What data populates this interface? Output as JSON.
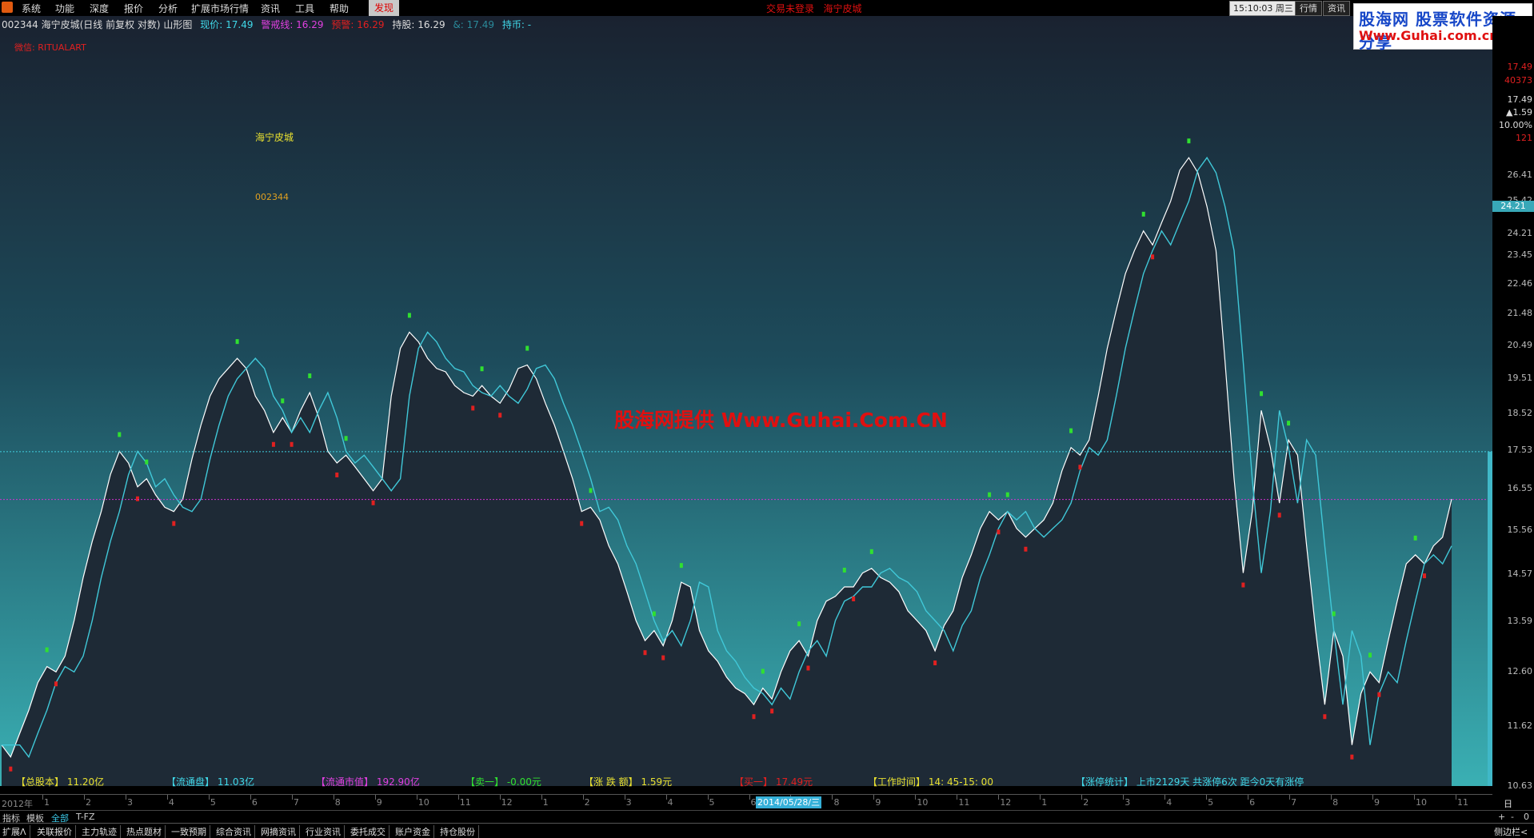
{
  "menubar": {
    "items": [
      "系统",
      "功能",
      "深度",
      "报价",
      "分析",
      "扩展市场行情",
      "资讯",
      "工具",
      "帮助",
      "发现"
    ],
    "notice": "交易未登录",
    "stock_name": "海宁皮城",
    "time": "15:10:03 周三",
    "buttons": [
      "行情",
      "资讯"
    ]
  },
  "watermark_logo": {
    "line1": "股海网 股票软件资源分享",
    "line2": "Www.Guhai.com.cn"
  },
  "info_line": {
    "title": "002344 海宁皮城(日线 前复权 对数) 山形图",
    "price_label": "现价: 17.49",
    "warn_label": "警戒线: 16.29",
    "alert_label": "预警: 16.29",
    "hold_label": "持股: 16.29",
    "amp_label": "&: 17.49",
    "coin_label": "持币: -"
  },
  "wechat": "微信: RITUALART",
  "annotations": {
    "name": "海宁皮城",
    "code": "002344"
  },
  "watermark_text": "股海网提供 Www.Guhai.Com.CN",
  "right_axis": {
    "quote": {
      "price": "17.49",
      "volume": "40373",
      "last": "17.49",
      "change": "▲1.59",
      "pct": "10.00%",
      "num": "121"
    },
    "ticks": [
      "26.41",
      "25.42",
      "24.21",
      "23.45",
      "22.46",
      "21.48",
      "20.49",
      "19.51",
      "18.52",
      "17.53",
      "16.55",
      "15.56",
      "14.57",
      "13.59",
      "12.60",
      "11.62",
      "10.63"
    ],
    "current_label": "24.21"
  },
  "stats": [
    {
      "label": "【总股本】",
      "value": "11.20亿",
      "color": "#e8e030"
    },
    {
      "label": "【流通盘】",
      "value": "11.03亿",
      "color": "#40d8e8"
    },
    {
      "label": "【流通市值】",
      "value": "192.90亿",
      "color": "#e040e0"
    },
    {
      "label": "【卖一】",
      "value": "-0.00元",
      "color": "#30e030"
    },
    {
      "label": "【涨 跌 额】",
      "value": "1.59元",
      "color": "#e8e030"
    },
    {
      "label": "【买一】",
      "value": "17.49元",
      "color": "#e02020"
    },
    {
      "label": "【工作时间】",
      "value": "14: 45-15: 00",
      "color": "#e8e030"
    },
    {
      "label": "【涨停统计】",
      "value": "上市2129天    共涨停6次    距今0天有涨停",
      "color": "#40d8e8"
    }
  ],
  "time_axis": {
    "year": "2012年",
    "months": [
      "1",
      "2",
      "3",
      "4",
      "5",
      "6",
      "7",
      "8",
      "9",
      "10",
      "11",
      "12",
      "1",
      "2",
      "3",
      "4",
      "5",
      "6",
      "7",
      "8",
      "9",
      "10",
      "11",
      "12",
      "1",
      "2",
      "3",
      "4",
      "5",
      "6",
      "7",
      "8",
      "9",
      "10",
      "11"
    ],
    "cursor_date": "2014/05/28/三",
    "period": "日线"
  },
  "tabs": [
    "指标",
    "模板",
    "全部",
    "T-FZ"
  ],
  "tab_controls": [
    "+",
    "-",
    "0"
  ],
  "bottom_buttons": [
    "扩展Λ",
    "关联报价",
    "主力轨迹",
    "热点题材",
    "一致预期",
    "综合资讯",
    "网摘资讯",
    "行业资讯",
    "委托成交",
    "账户资金",
    "持仓股份"
  ],
  "sidebar_toggle": "侧边栏<",
  "chart_data": {
    "type": "area",
    "title": "002344 海宁皮城(日线 前复权 对数) 山形图",
    "ylim": [
      10.63,
      27.4
    ],
    "yticks": [
      26.41,
      25.42,
      24.21,
      23.45,
      22.46,
      21.48,
      20.49,
      19.51,
      18.52,
      17.53,
      16.55,
      15.56,
      14.57,
      13.59,
      12.6,
      11.62,
      10.63
    ],
    "reference_lines": [
      {
        "name": "警戒线",
        "value": 17.49,
        "color": "#40d0e0"
      },
      {
        "name": "预警",
        "value": 16.29,
        "color": "#d030d0"
      }
    ],
    "series": [
      {
        "values": [
          11.3,
          11.1,
          11.5,
          11.9,
          12.4,
          12.7,
          12.6,
          12.9,
          13.6,
          14.5,
          15.3,
          16.0,
          16.9,
          17.5,
          17.2,
          16.6,
          16.8,
          16.4,
          16.1,
          16.0,
          16.3,
          17.3,
          18.2,
          19.0,
          19.5,
          19.8,
          20.1,
          19.8,
          19.0,
          18.6,
          18.0,
          18.4,
          18.0,
          18.6,
          19.1,
          18.4,
          17.5,
          17.2,
          17.4,
          17.1,
          16.8,
          16.5,
          16.8,
          19.0,
          20.4,
          20.9,
          20.6,
          20.1,
          19.8,
          19.7,
          19.3,
          19.1,
          19.0,
          19.3,
          19.0,
          18.8,
          19.2,
          19.8,
          19.9,
          19.5,
          18.8,
          18.2,
          17.5,
          16.8,
          16.0,
          16.1,
          15.8,
          15.2,
          14.8,
          14.2,
          13.6,
          13.2,
          13.4,
          13.1,
          13.6,
          14.4,
          14.3,
          13.4,
          13.0,
          12.8,
          12.5,
          12.3,
          12.2,
          12.0,
          12.3,
          12.1,
          12.6,
          13.0,
          13.2,
          12.9,
          13.6,
          14.0,
          14.1,
          14.3,
          14.3,
          14.6,
          14.7,
          14.5,
          14.4,
          14.2,
          13.8,
          13.6,
          13.4,
          13.0,
          13.5,
          13.8,
          14.5,
          15.0,
          15.6,
          16.0,
          15.8,
          16.0,
          15.6,
          15.4,
          15.6,
          15.8,
          16.2,
          17.0,
          17.6,
          17.4,
          17.8,
          19.0,
          20.4,
          21.6,
          22.8,
          23.6,
          24.3,
          23.8,
          24.6,
          25.4,
          26.6,
          27.1,
          26.5,
          25.2,
          23.6,
          20.0,
          16.8,
          14.6,
          16.0,
          18.6,
          17.6,
          16.2,
          17.8,
          17.4,
          15.2,
          13.4,
          12.0,
          13.4,
          12.9,
          11.3,
          12.2,
          12.6,
          12.4,
          13.2,
          14.0,
          14.8,
          15.0,
          14.8,
          15.2,
          15.4,
          16.3
        ]
      }
    ]
  }
}
